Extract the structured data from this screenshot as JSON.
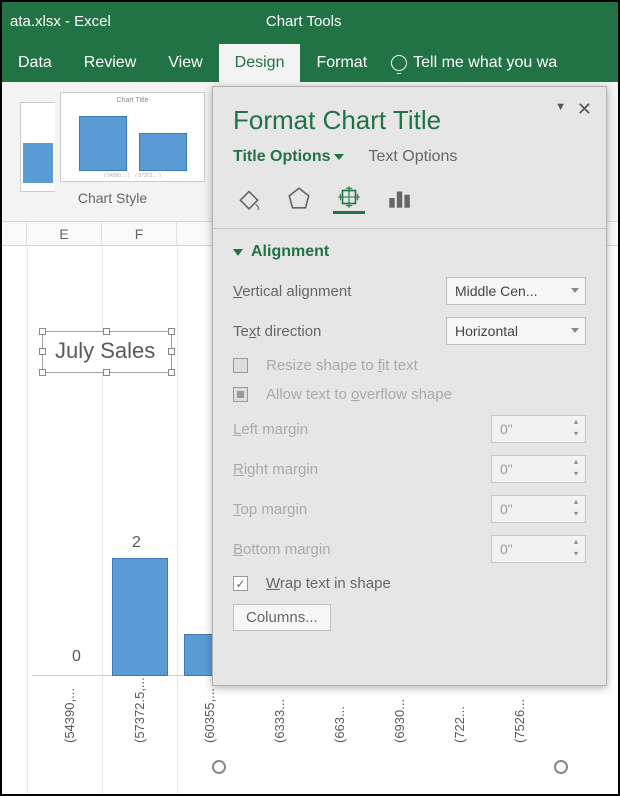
{
  "titlebar": {
    "filename": "ata.xlsx - Excel",
    "tools": "Chart Tools"
  },
  "ribbon": {
    "tabs": [
      "Data",
      "Review",
      "View",
      "Design",
      "Format"
    ],
    "active_index": 3,
    "tellme": "Tell me what you wa"
  },
  "chart_styles": {
    "thumb_title": "Chart Title",
    "group_label": "Chart Style"
  },
  "columns": [
    "E",
    "F"
  ],
  "chart_title": {
    "text": "July Sales"
  },
  "chart_data": {
    "type": "bar",
    "title": "July Sales",
    "categories": [
      "(54390,...",
      "(57372.5,...",
      "(60355,...",
      "(6333...",
      "(663...",
      "(6930...",
      "(722...",
      "(7526..."
    ],
    "values": [
      0,
      2,
      null,
      null,
      null,
      null,
      null,
      null
    ],
    "xlabel": "",
    "ylabel": "",
    "ylim": [
      0,
      3
    ]
  },
  "pane": {
    "title": "Format Chart Title",
    "tabs": {
      "title_options": "Title Options",
      "text_options": "Text Options"
    },
    "section": "Alignment",
    "fields": {
      "valign_label": "Vertical alignment",
      "valign_value": "Middle Cen...",
      "textdir_label": "Text direction",
      "textdir_value": "Horizontal",
      "resize_label": "Resize shape to fit text",
      "overflow_label": "Allow text to overflow shape",
      "left_label": "Left margin",
      "left_value": "0\"",
      "right_label": "Right margin",
      "right_value": "0\"",
      "top_label": "Top margin",
      "top_value": "0\"",
      "bottom_label": "Bottom margin",
      "bottom_value": "0\"",
      "wrap_label": "Wrap text in shape",
      "columns_btn": "Columns..."
    }
  }
}
